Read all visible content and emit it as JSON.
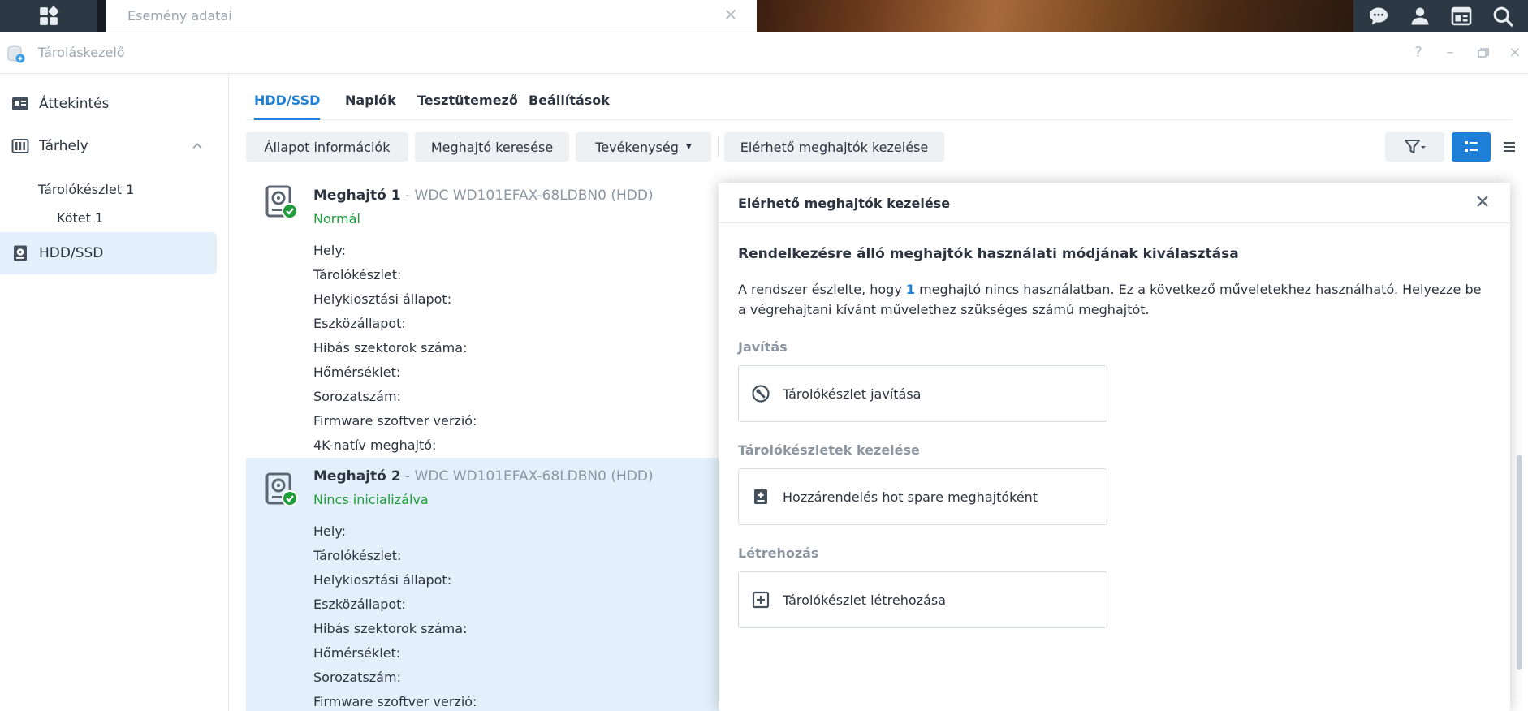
{
  "taskbar": {
    "window_title": "Esemény adatai",
    "icons": [
      "apps-grid-icon",
      "chat-icon",
      "user-icon",
      "widgets-icon",
      "search-icon"
    ]
  },
  "app": {
    "title": "Tároláskezelő",
    "window_controls": [
      "help-icon",
      "minimize-icon",
      "maximize-icon",
      "close-icon"
    ]
  },
  "sidebar": {
    "items": [
      {
        "label": "Áttekintés",
        "icon": "overview-icon"
      },
      {
        "label": "Tárhely",
        "icon": "storage-icon"
      },
      {
        "label": "Tárolókészlet 1"
      },
      {
        "label": "Kötet 1"
      },
      {
        "label": "HDD/SSD",
        "icon": "hdd-icon",
        "active": true
      }
    ]
  },
  "tabs": [
    {
      "label": "HDD/SSD",
      "active": true
    },
    {
      "label": "Naplók"
    },
    {
      "label": "Tesztütemező"
    },
    {
      "label": "Beállítások"
    }
  ],
  "toolbar": {
    "status_info": "Állapot információk",
    "find_drive": "Meghajtó keresése",
    "activity": "Tevékenység",
    "manage_available": "Elérhető meghajtók kezelése",
    "icons": [
      "filter-icon",
      "list-detail-icon",
      "list-icon"
    ]
  },
  "drives": [
    {
      "name": "Meghajtó 1",
      "model": " - WDC WD101EFAX-68LDBN0 (HDD)",
      "status": "Normál",
      "props": [
        "Hely:",
        "Tárolókészlet:",
        "Helykiosztási állapot:",
        "Eszközállapot:",
        "Hibás szektorok száma:",
        "Hőmérséklet:",
        "Sorozatszám:",
        "Firmware szoftver verzió:",
        "4K-natív meghajtó:"
      ]
    },
    {
      "name": "Meghajtó 2",
      "model": " - WDC WD101EFAX-68LDBN0 (HDD)",
      "status": "Nincs inicializálva",
      "props": [
        "Hely:",
        "Tárolókészlet:",
        "Helykiosztási állapot:",
        "Eszközállapot:",
        "Hibás szektorok száma:",
        "Hőmérséklet:",
        "Sorozatszám:",
        "Firmware szoftver verzió:"
      ]
    }
  ],
  "modal": {
    "title": "Elérhető meghajtók kezelése",
    "heading": "Rendelkezésre álló meghajtók használati módjának kiválasztása",
    "desc_before": "A rendszer észlelte, hogy ",
    "desc_count": "1",
    "desc_after": " meghajtó nincs használatban. Ez a következő műveletekhez használható. Helyezze be a végrehajtani kívánt művelethez szükséges számú meghajtót.",
    "sections": [
      {
        "title": "Javítás",
        "action": "Tárolókészlet javítása",
        "icon": "repair-icon"
      },
      {
        "title": "Tárolókészletek kezelése",
        "action": "Hozzárendelés hot spare meghajtóként",
        "icon": "hot-spare-icon"
      },
      {
        "title": "Létrehozás",
        "action": "Tárolókészlet létrehozása",
        "icon": "create-plus-icon"
      }
    ]
  },
  "colors": {
    "accent": "#1d7fd6",
    "status_ok": "#1f9d3a",
    "taskbar": "#1f2933",
    "selected_row": "#e3f0fb"
  }
}
